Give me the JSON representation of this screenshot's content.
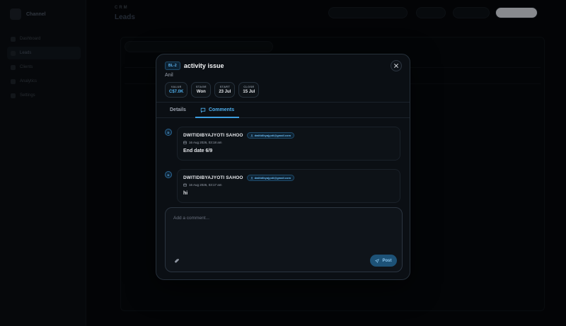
{
  "app": {
    "brand_name": "Channel",
    "breadcrumb": "CRM",
    "page_title": "Leads",
    "sidebar": [
      {
        "label": "Dashboard"
      },
      {
        "label": "Leads"
      },
      {
        "label": "Clients"
      },
      {
        "label": "Analytics"
      },
      {
        "label": "Settings"
      }
    ]
  },
  "modal": {
    "id_badge": "BL-2",
    "title": "activity issue",
    "subtitle": "Anil",
    "chips": [
      {
        "label": "VALUE",
        "value": "C$7.0K"
      },
      {
        "label": "STAGE",
        "value": "Won"
      },
      {
        "label": "START",
        "value": "23 Jul"
      },
      {
        "label": "CLOSE",
        "value": "15 Jul"
      }
    ],
    "tabs": [
      {
        "label": "Details"
      },
      {
        "label": "Comments"
      }
    ],
    "comments": [
      {
        "avatar": "D",
        "author": "DWITIDIBYAJYOTI SAHOO",
        "email": "dwitidibyajyoti@gmail.com",
        "time": "16 Aug 2026, 03:18 am",
        "text": "End date 6/9"
      },
      {
        "avatar": "D",
        "author": "DWITIDIBYAJYOTI SAHOO",
        "email": "dwitidibyajyoti@gmail.com",
        "time": "16 Aug 2026, 03:17 am",
        "text": "hi"
      }
    ],
    "composer": {
      "placeholder": "Add a comment...",
      "post_label": "Post"
    }
  },
  "colors": {
    "accent": "#4fb0ef",
    "modal_bg": "#0b0f14",
    "page_bg": "#05070a"
  }
}
